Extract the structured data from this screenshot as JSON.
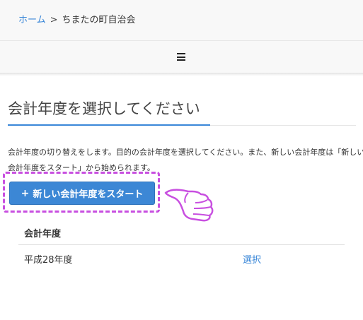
{
  "breadcrumb": {
    "home": "ホーム",
    "separator": ">",
    "current": "ちまたの町自治会"
  },
  "navbar": {
    "menu_icon": "hamburger-menu-icon"
  },
  "page": {
    "title": "会計年度を選択してください",
    "description": "会計年度の切り替えをします。目的の会計年度を選択してください。また、新しい会計年度は「新しい会計年度をスタート」から始められます。"
  },
  "actions": {
    "start_plus": "+",
    "start_label": "新しい会計年度をスタート"
  },
  "table": {
    "header": "会計年度",
    "rows": [
      {
        "year": "平成28年度",
        "action": "選択"
      }
    ]
  },
  "colors": {
    "accent": "#3a87d8",
    "button": "#3c87d5",
    "highlight": "#c84fe0"
  }
}
